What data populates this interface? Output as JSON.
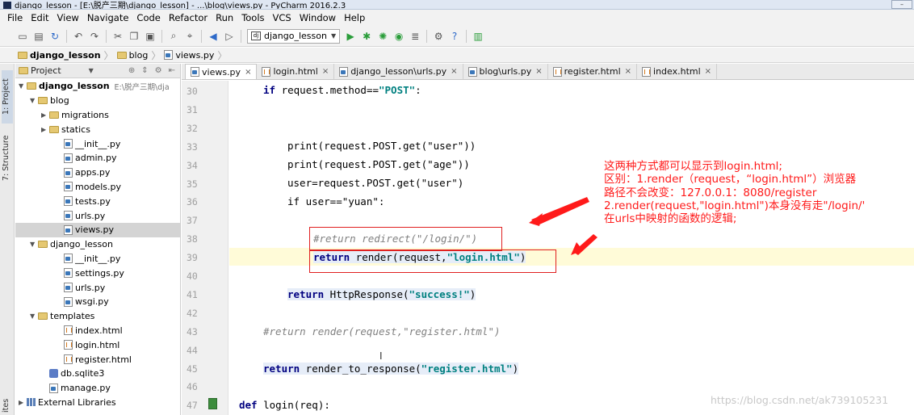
{
  "window": {
    "title": "django_lesson - [E:\\脱产三期\\django_lesson] - ...\\blog\\views.py - PyCharm 2016.2.3"
  },
  "menu": [
    "File",
    "Edit",
    "View",
    "Navigate",
    "Code",
    "Refactor",
    "Run",
    "Tools",
    "VCS",
    "Window",
    "Help"
  ],
  "toolbar": {
    "run_config": "django_lesson"
  },
  "breadcrumb": [
    "django_lesson",
    "blog",
    "views.py"
  ],
  "project_panel": {
    "title": "Project",
    "side_tabs": [
      "1: Project",
      "7: Structure",
      "ites"
    ]
  },
  "tree": [
    {
      "label": "django_lesson",
      "path": "E:\\脱产三期\\dja",
      "depth": 0,
      "open": true,
      "kind": "folder",
      "bold": true
    },
    {
      "label": "blog",
      "depth": 1,
      "open": true,
      "kind": "folder"
    },
    {
      "label": "migrations",
      "depth": 2,
      "open": false,
      "kind": "folder"
    },
    {
      "label": "statics",
      "depth": 2,
      "open": false,
      "kind": "folder"
    },
    {
      "label": "__init__.py",
      "depth": 3,
      "kind": "py"
    },
    {
      "label": "admin.py",
      "depth": 3,
      "kind": "py"
    },
    {
      "label": "apps.py",
      "depth": 3,
      "kind": "py"
    },
    {
      "label": "models.py",
      "depth": 3,
      "kind": "py"
    },
    {
      "label": "tests.py",
      "depth": 3,
      "kind": "py"
    },
    {
      "label": "urls.py",
      "depth": 3,
      "kind": "py"
    },
    {
      "label": "views.py",
      "depth": 3,
      "kind": "py",
      "selected": true
    },
    {
      "label": "django_lesson",
      "depth": 1,
      "open": true,
      "kind": "folder"
    },
    {
      "label": "__init__.py",
      "depth": 3,
      "kind": "py"
    },
    {
      "label": "settings.py",
      "depth": 3,
      "kind": "py"
    },
    {
      "label": "urls.py",
      "depth": 3,
      "kind": "py"
    },
    {
      "label": "wsgi.py",
      "depth": 3,
      "kind": "py"
    },
    {
      "label": "templates",
      "depth": 1,
      "open": true,
      "kind": "folder"
    },
    {
      "label": "index.html",
      "depth": 3,
      "kind": "html"
    },
    {
      "label": "login.html",
      "depth": 3,
      "kind": "html"
    },
    {
      "label": "register.html",
      "depth": 3,
      "kind": "html"
    },
    {
      "label": "db.sqlite3",
      "depth": 2,
      "kind": "db"
    },
    {
      "label": "manage.py",
      "depth": 2,
      "kind": "py"
    },
    {
      "label": "External Libraries",
      "depth": 0,
      "open": false,
      "kind": "lib"
    }
  ],
  "tabs": [
    {
      "label": "views.py",
      "kind": "py",
      "active": true
    },
    {
      "label": "login.html",
      "kind": "html"
    },
    {
      "label": "django_lesson\\urls.py",
      "kind": "py"
    },
    {
      "label": "blog\\urls.py",
      "kind": "py"
    },
    {
      "label": "register.html",
      "kind": "html"
    },
    {
      "label": "index.html",
      "kind": "html"
    }
  ],
  "line_numbers": [
    "30",
    "31",
    "32",
    "33",
    "34",
    "35",
    "36",
    "37",
    "38",
    "39",
    "40",
    "41",
    "42",
    "43",
    "44",
    "45",
    "46",
    "47"
  ],
  "code": {
    "l30": "if request.method==\"POST\":",
    "l33": "print(request.POST.get(\"user\"))",
    "l34": "print(request.POST.get(\"age\"))",
    "l35": "user=request.POST.get(\"user\")",
    "l36": "if user==\"yuan\":",
    "l38": "#return redirect(\"/login/\")",
    "l39_kw": "return",
    "l39_rest": " render(request,",
    "l39_str": "\"login.html\"",
    "l39_end": ")",
    "l41_kw": "return",
    "l41_rest": " HttpResponse(",
    "l41_str": "\"success!\"",
    "l41_end": ")",
    "l43": "#return render(request,\"register.html\")",
    "l45_kw": "return",
    "l45_rest": " render_to_response(",
    "l45_str": "\"register.html\"",
    "l45_end": ")",
    "l47_kw": "def",
    "l47_rest": " login(req):"
  },
  "annotation": [
    "这两种方式都可以显示到login.html;",
    "区别：1.render（request，“login.html”）浏览器",
    "路径不会改变：127.0.0.1：8080/register",
    "2.render(request,\"login.html\")本身没有走\"/login/'",
    "在urls中映射的函数的逻辑;"
  ],
  "watermark": "https://blog.csdn.net/ak739105231",
  "colors": {
    "annotation": "#ff1a1a",
    "keyword": "#000080",
    "string": "#008080",
    "comment": "#808080"
  }
}
